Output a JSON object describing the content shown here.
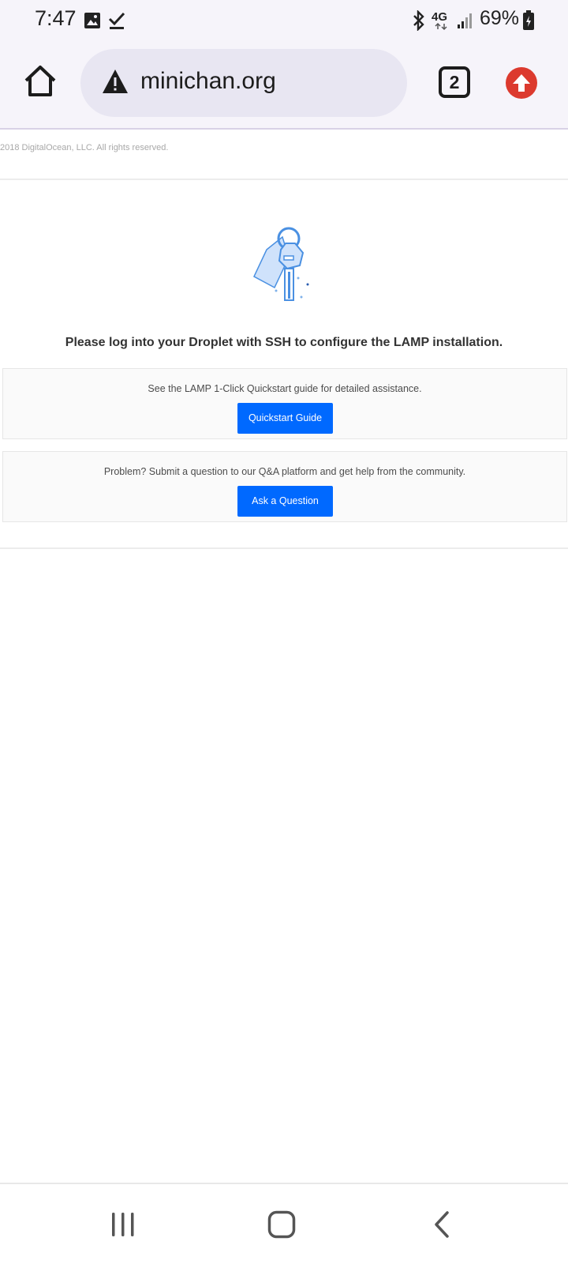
{
  "status_bar": {
    "time": "7:47",
    "network": "4G",
    "battery": "69%"
  },
  "browser": {
    "url": "minichan.org",
    "tab_count": "2"
  },
  "page": {
    "copyright": "2018 DigitalOcean, LLC. All rights reserved.",
    "heading": "Please log into your Droplet with SSH to configure the LAMP installation.",
    "cards": [
      {
        "text": "See the LAMP 1-Click Quickstart guide for detailed assistance.",
        "button": "Quickstart Guide"
      },
      {
        "text": "Problem? Submit a question to our Q&A platform and get help from the community.",
        "button": "Ask a Question"
      }
    ]
  },
  "colors": {
    "accent": "#0069ff",
    "update_red": "#dc3a2e",
    "chrome_bg": "#f6f4fa"
  },
  "icons": [
    "image-icon",
    "check-icon",
    "bluetooth-icon",
    "network-4g-icon",
    "signal-icon",
    "battery-icon",
    "home-icon",
    "warning-icon",
    "tabs-icon",
    "update-icon",
    "key-illustration",
    "recent-apps-icon",
    "home-nav-icon",
    "back-icon"
  ]
}
